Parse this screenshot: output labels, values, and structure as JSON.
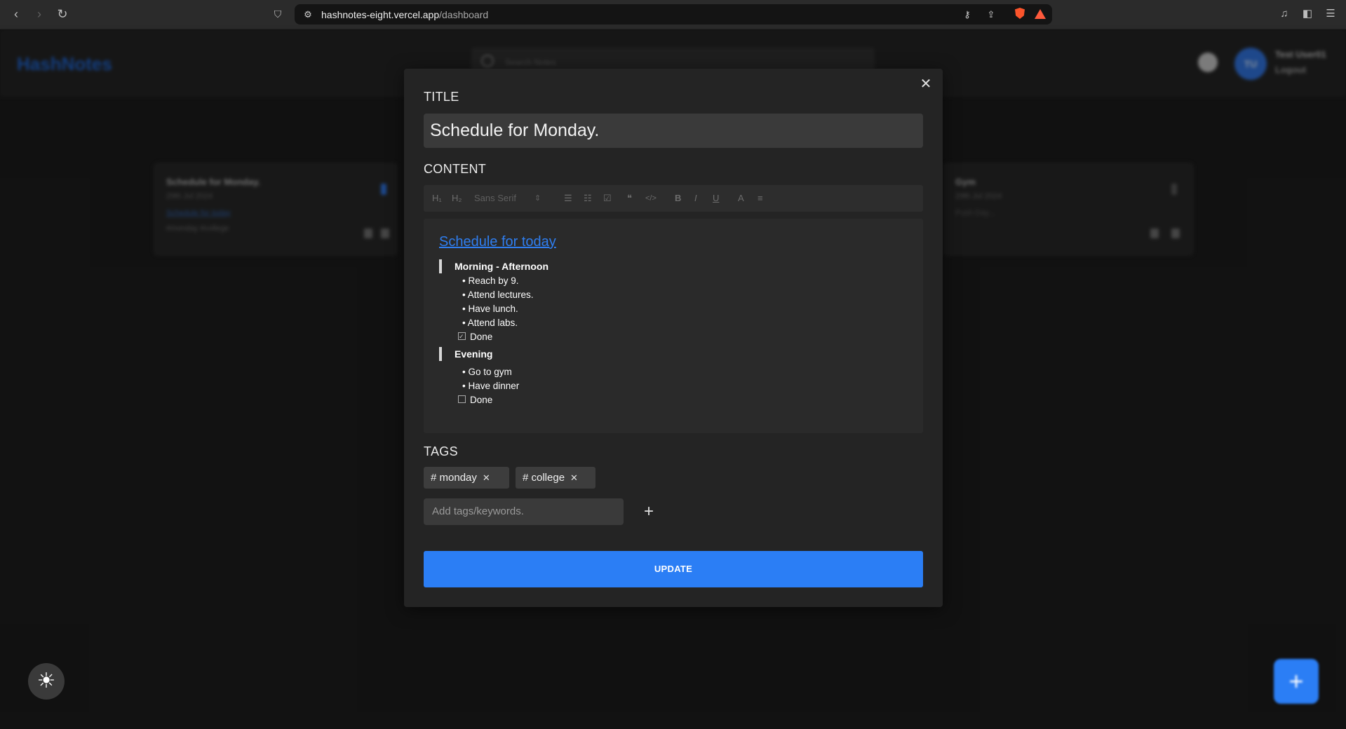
{
  "browser": {
    "url_host": "hashnotes-eight.vercel.app",
    "url_path": "/dashboard",
    "icons": [
      "back-icon",
      "forward-icon",
      "reload-icon",
      "bookmark-icon",
      "site-info-icon",
      "key-icon",
      "share-icon",
      "brave-shield-icon",
      "brave-rewards-icon",
      "media-icon",
      "sidebar-icon",
      "menu-icon"
    ]
  },
  "app": {
    "logo": "HashNotes",
    "search_placeholder": "Search Notes",
    "avatar_initials": "TU",
    "user_name": "Test User01",
    "logout": "Logout"
  },
  "background_notes": [
    {
      "title": "Schedule for Monday.",
      "date": "29th Jul 2024",
      "preview": "Schedule for today",
      "tags": "#monday #college"
    },
    {
      "title": "Gym",
      "date": "29th Jul 2024",
      "preview": "Push Day...",
      "tags": ""
    }
  ],
  "modal": {
    "title_label": "TITLE",
    "title_value": "Schedule for Monday.",
    "content_label": "CONTENT",
    "toolbar": {
      "h1": "H₁",
      "h2": "H₂",
      "font": "Sans Serif",
      "font_arrow": "⇕",
      "ordered_list": "☰",
      "bullet_list": "☷",
      "check_list": "☑",
      "quote": "❝",
      "code": "</>",
      "bold": "B",
      "italic": "I",
      "underline": "U",
      "color": "A",
      "align": "≡"
    },
    "content": {
      "heading": "Schedule for today",
      "sections": [
        {
          "title": "Morning - Afternoon",
          "bullets": [
            "• Reach by 9.",
            "• Attend lectures.",
            "• Have lunch.",
            "• Attend labs."
          ],
          "check": {
            "label": "Done",
            "checked": true
          }
        },
        {
          "title": "Evening",
          "bullets": [
            "• Go to gym",
            "• Have dinner"
          ],
          "check": {
            "label": "Done",
            "checked": false
          }
        }
      ]
    },
    "tags_label": "TAGS",
    "tags": [
      "# monday",
      "# college"
    ],
    "tag_remove_symbol": "✕",
    "tag_input_placeholder": "Add tags/keywords.",
    "add_tag_symbol": "+",
    "close_symbol": "✕",
    "update_label": "UPDATE"
  },
  "theme_toggle_symbol": "☀",
  "fab_symbol": "+",
  "colors": {
    "accent": "#2b7ef5",
    "modal_bg": "#242424",
    "input_bg": "#3a3a3a",
    "link": "#2f7ef0"
  }
}
